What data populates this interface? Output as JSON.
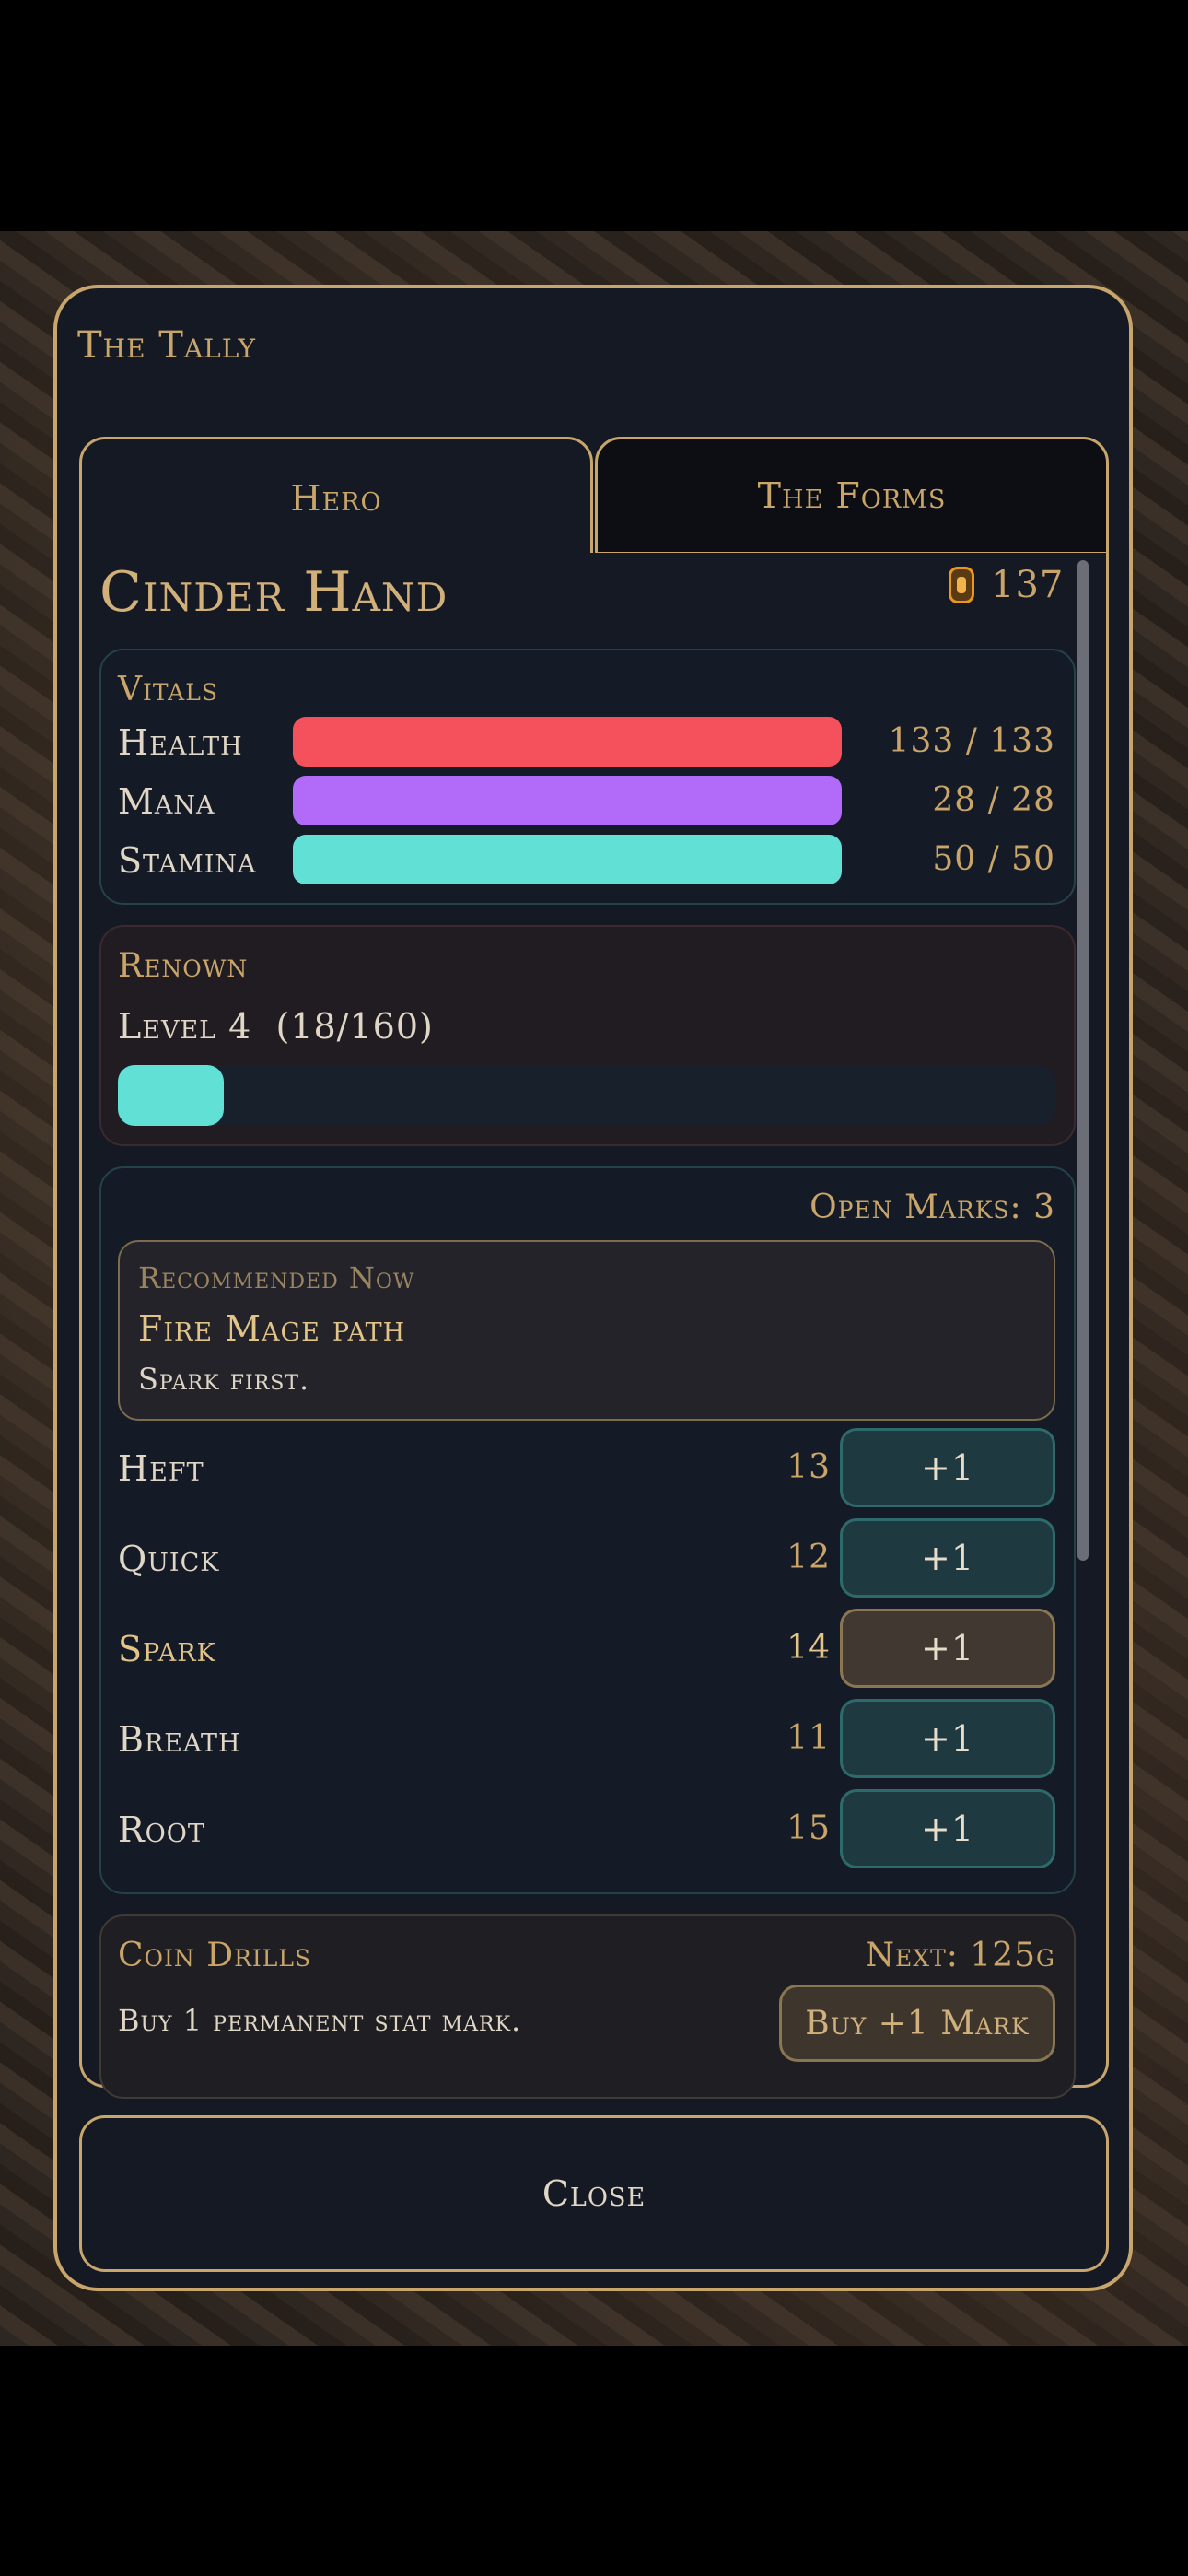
{
  "window": {
    "title": "The Tally"
  },
  "tabs": [
    {
      "label": "Hero",
      "active": true
    },
    {
      "label": "The Forms",
      "active": false
    }
  ],
  "hero": {
    "name": "Cinder Hand",
    "gold": "137"
  },
  "vitals": {
    "heading": "Vitals",
    "rows": [
      {
        "label": "Health",
        "value": "133 / 133",
        "fraction": 1.0,
        "color": "#f5515c"
      },
      {
        "label": "Mana",
        "value": "28 / 28",
        "fraction": 1.0,
        "color": "#b26bf8"
      },
      {
        "label": "Stamina",
        "value": "50 / 50",
        "fraction": 1.0,
        "color": "#61e0d6"
      }
    ]
  },
  "renown": {
    "heading": "Renown",
    "level_text": "Level 4  (18/160)",
    "progress": 0.1125,
    "color": "#61e0d6"
  },
  "stats": {
    "open_marks": "Open Marks: 3",
    "recommendation": {
      "heading": "Recommended Now",
      "path": "Fire Mage path",
      "tip": "Spark first."
    },
    "rows": [
      {
        "label": "Heft",
        "value": "13",
        "button": "+1",
        "highlight": false
      },
      {
        "label": "Quick",
        "value": "12",
        "button": "+1",
        "highlight": false
      },
      {
        "label": "Spark",
        "value": "14",
        "button": "+1",
        "highlight": true
      },
      {
        "label": "Breath",
        "value": "11",
        "button": "+1",
        "highlight": false
      },
      {
        "label": "Root",
        "value": "15",
        "button": "+1",
        "highlight": false
      }
    ]
  },
  "drills": {
    "heading": "Coin Drills",
    "next": "Next: 125g",
    "desc": "Buy 1 permanent stat mark.",
    "button": "Buy +1 Mark"
  },
  "footer": {
    "close_label": "Close"
  },
  "colors": {
    "accent": "#c7a56b",
    "panel": "#151923",
    "teal": "#61e0d6"
  }
}
